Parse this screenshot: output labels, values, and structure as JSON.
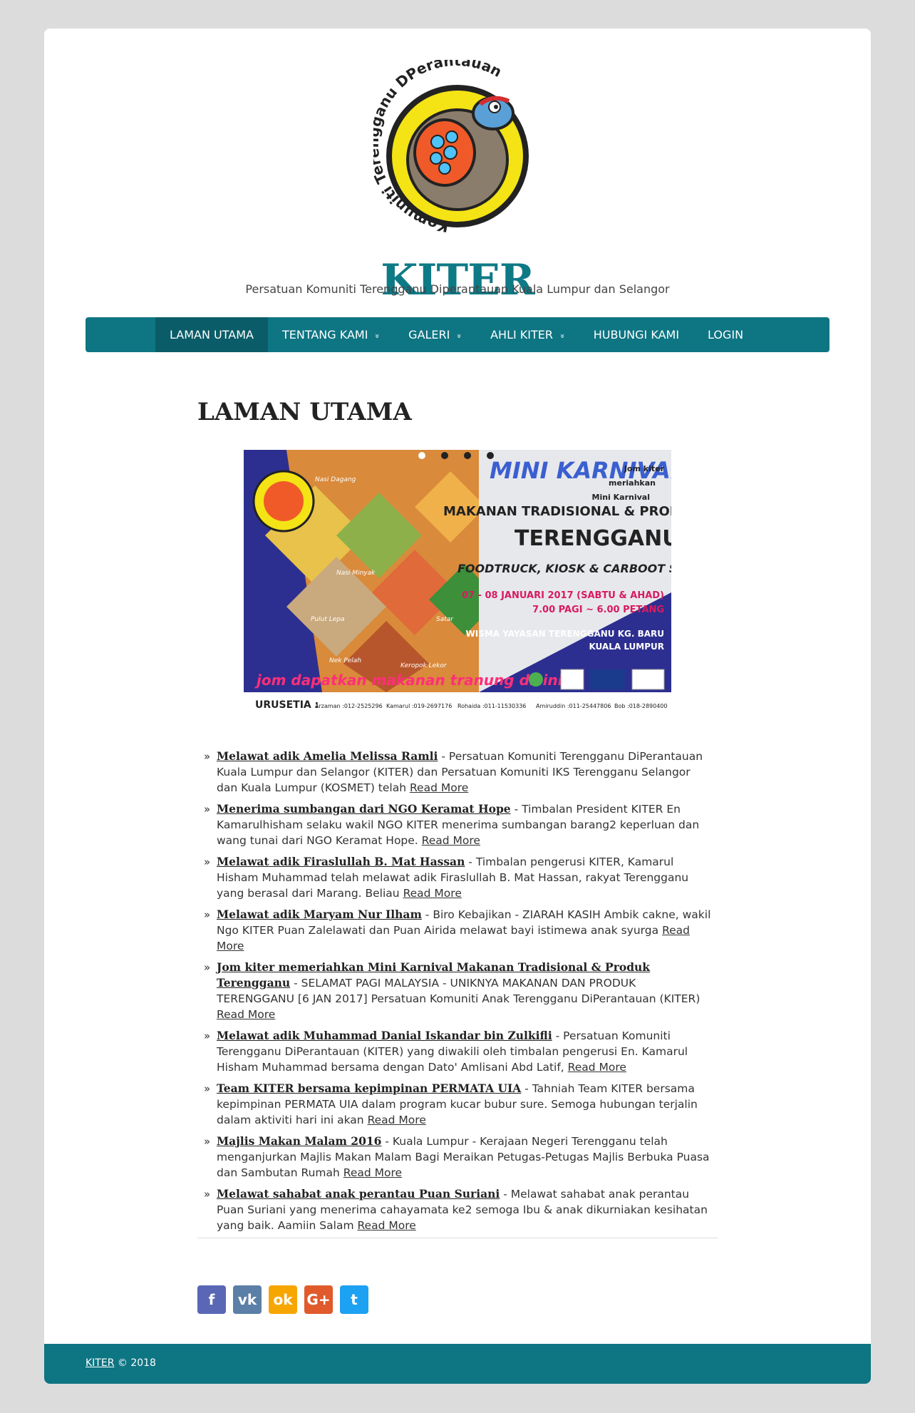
{
  "site": {
    "logo_text": "Komuniti Terengganu DPerantauan",
    "title": "KITER",
    "description": "Persatuan Komuniti Terengganu Diperantauan Kuala Lumpur dan Selangor"
  },
  "nav": {
    "items": [
      {
        "label": "LAMAN UTAMA",
        "active": true,
        "dropdown": false
      },
      {
        "label": "TENTANG KAMI",
        "active": false,
        "dropdown": true
      },
      {
        "label": "GALERI",
        "active": false,
        "dropdown": true
      },
      {
        "label": "AHLI KITER",
        "active": false,
        "dropdown": true
      },
      {
        "label": "HUBUNGI KAMI",
        "active": false,
        "dropdown": false
      },
      {
        "label": "LOGIN",
        "active": false,
        "dropdown": false
      }
    ],
    "dropdown_glyph": "»"
  },
  "page": {
    "title": "LAMAN UTAMA"
  },
  "banner": {
    "caption": [
      "Jom kiter",
      "meriahkan",
      "Mini Karnival"
    ],
    "headline1": "MINI KARNIVAL",
    "headline2": "MAKANAN TRADISIONAL & PRODUK",
    "headline3": "TERENGGANU",
    "headline4": "FOODTRUCK, KIOSK & CARBOOT SALE",
    "date": "07 - 08 JANUARI 2017 (SABTU & AHAD)",
    "time": "7.00 PAGI ~ 6.00 PETANG",
    "venue1": "WISMA YAYASAN TERENGGANU KG. BARU",
    "venue2": "KUALA LUMPUR",
    "slogan": "jom dapatkan makanan tranung disini",
    "urusetia_label": "URUSETIA :",
    "contacts": [
      "Arzaman :012-2525296",
      "Kamarul :019-2697176",
      "Rohaida :011-11530336",
      "Amiruddin :011-25447806",
      "Bob :018-2890400"
    ],
    "food_labels": [
      "Nasi Dagang",
      "Nasi Minyak",
      "Pulut Lepa",
      "Keropok Lekor",
      "Satar",
      "Nek Pelah"
    ],
    "slide_count": 4
  },
  "news": [
    {
      "title": "Melawat adik Amelia Melissa Ramli",
      "text": " - Persatuan Komuniti Terengganu DiPerantauan Kuala Lumpur dan Selangor (KITER) dan Persatuan Komuniti IKS Terengganu Selangor dan Kuala Lumpur (KOSMET) telah ",
      "more": "Read More"
    },
    {
      "title": "Menerima sumbangan dari NGO Keramat Hope",
      "text": " - Timbalan President KITER En Kamarulhisham selaku wakil NGO KITER menerima sumbangan barang2 keperluan dan wang tunai dari NGO Keramat Hope. ",
      "more": "Read More"
    },
    {
      "title": "Melawat adik Firaslullah B. Mat Hassan",
      "text": " - Timbalan pengerusi KITER, Kamarul Hisham Muhammad telah melawat adik Firaslullah B. Mat Hassan, rakyat Terengganu yang berasal dari Marang. Beliau ",
      "more": "Read More"
    },
    {
      "title": "Melawat adik Maryam Nur Ilham",
      "text": " - Biro Kebajikan - ZIARAH KASIH Ambik cakne, wakil Ngo KITER Puan Zalelawati dan Puan Airida melawat bayi istimewa anak syurga ",
      "more": "Read More"
    },
    {
      "title": "Jom kiter memeriahkan Mini Karnival Makanan Tradisional & Produk Terengganu",
      "text": " - SELAMAT PAGI MALAYSIA - UNIKNYA MAKANAN DAN PRODUK TERENGGANU [6 JAN 2017] Persatuan Komuniti Anak Terengganu DiPerantauan (KITER) ",
      "more": "Read More"
    },
    {
      "title": "Melawat adik Muhammad Danial Iskandar bin Zulkifli",
      "text": " - Persatuan Komuniti Terengganu DiPerantauan (KITER) yang diwakili oleh timbalan pengerusi En. Kamarul Hisham Muhammad bersama dengan Dato' Amlisani Abd Latif, ",
      "more": "Read More"
    },
    {
      "title": "Team KITER bersama kepimpinan PERMATA UIA",
      "text": " - Tahniah Team KITER bersama kepimpinan PERMATA UIA dalam program kucar bubur sure. Semoga hubungan terjalin dalam aktiviti hari ini akan ",
      "more": "Read More"
    },
    {
      "title": "Majlis Makan Malam 2016",
      "text": " - Kuala Lumpur - Kerajaan Negeri Terengganu telah menganjurkan Majlis Makan Malam Bagi Meraikan Petugas-Petugas Majlis Berbuka Puasa dan Sambutan Rumah ",
      "more": "Read More"
    },
    {
      "title": "Melawat sahabat anak perantau Puan Suriani",
      "text": " - Melawat sahabat anak perantau Puan Suriani yang menerima cahayamata ke2 semoga Ibu & anak dikurniakan kesihatan yang baik. Aamiin Salam ",
      "more": "Read More"
    }
  ],
  "social": [
    {
      "name": "facebook",
      "glyph": "f",
      "color": "#5a67b5"
    },
    {
      "name": "vk",
      "glyph": "vk",
      "color": "#5b7fa6"
    },
    {
      "name": "odnoklassniki",
      "glyph": "ok",
      "color": "#f7a600"
    },
    {
      "name": "google-plus",
      "glyph": "G+",
      "color": "#e05a2b"
    },
    {
      "name": "twitter",
      "glyph": "t",
      "color": "#1da1f2"
    }
  ],
  "footer": {
    "link": "KITER",
    "text": " © 2018"
  }
}
